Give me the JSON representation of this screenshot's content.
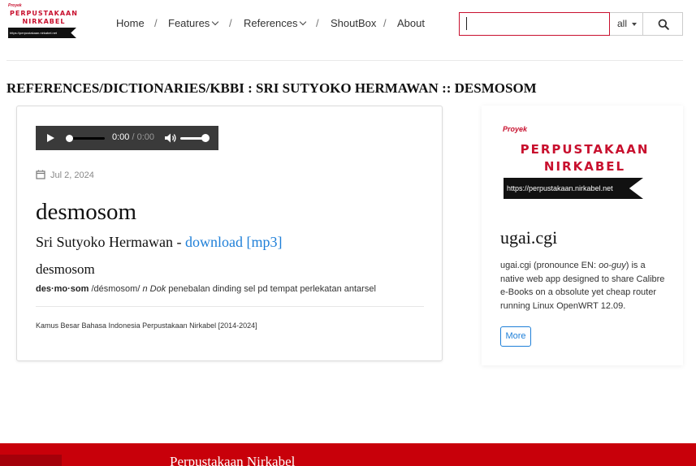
{
  "brand": {
    "proyek": "Proyek",
    "line1": "PERPUSTAKAAN",
    "line2": "NIRKABEL",
    "url": "https://perpustakaan.nirkabel.net",
    "color": "#c8102e"
  },
  "nav": {
    "home": "Home",
    "features": "Features",
    "references": "References",
    "shoutbox": "ShoutBox",
    "about": "About",
    "separator": "/"
  },
  "search": {
    "value": "",
    "scope": "all",
    "button_icon": "search-icon"
  },
  "page_title": "REFERENCES/DICTIONARIES/KBBI : SRI SUTYOKO HERMAWAN :: DESMOSOM",
  "entry": {
    "player": {
      "current_time": "0:00",
      "separator": "/",
      "duration": "0:00"
    },
    "date": "Jul 2, 2024",
    "title": "desmosom",
    "author": "Sri Sutyoko Hermawan",
    "author_sep": "-",
    "download_label": "download [mp3]",
    "headword": "desmosom",
    "syllables": "des·mo·som",
    "pronunciation": "/désmosom/",
    "class": "n Dok",
    "definition": "penebalan dinding sel pd tempat perlekatan antarsel",
    "source": "Kamus Besar Bahasa Indonesia Perpustakaan Nirkabel [2014-2024]"
  },
  "sidebar": {
    "title": "ugai.cgi",
    "desc_part1": "ugai.cgi (pronounce EN: ",
    "desc_italic": "oo-guy",
    "desc_part2": ") is a native web app designed to share Calibre e-Books on a obsolute yet cheap router running Linux OpenWRT 12.09.",
    "more_label": "More"
  },
  "footer": {
    "title": "Perpustakaan Nirkabel",
    "color": "#c8000a"
  }
}
